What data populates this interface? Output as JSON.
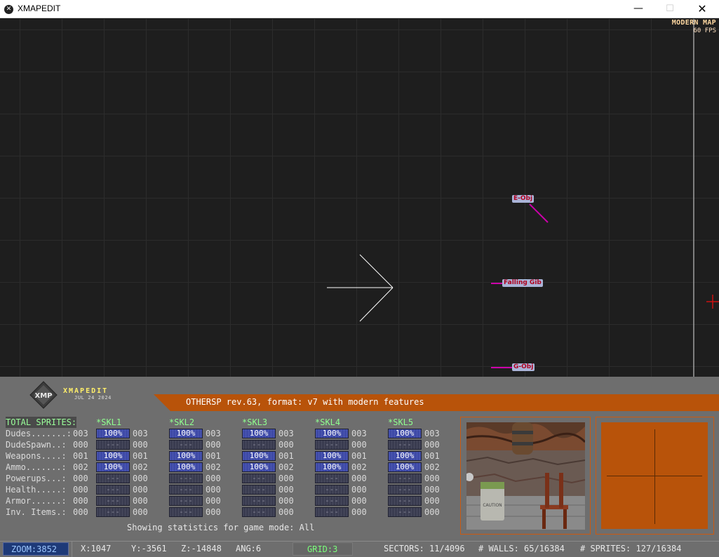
{
  "window": {
    "title": "XMAPEDIT",
    "minimize_glyph": "—",
    "maximize_glyph": "☐",
    "close_glyph": "✕"
  },
  "map": {
    "mode_label": "MODERN MAP",
    "fps_label": "60 FPS",
    "sprites": [
      {
        "label": "E-Obj"
      },
      {
        "label": "Falling Gib"
      },
      {
        "label": "G-Obj"
      }
    ]
  },
  "panel": {
    "logo_name": "XMAPEDIT",
    "logo_date": "JUL 24 2024",
    "map_info": "OTHERSP rev.63, format: v7 with modern features",
    "total_header": "TOTAL SPRITES:",
    "rows": [
      {
        "label": "Dudes.......:",
        "total": "003"
      },
      {
        "label": "DudeSpawn..:",
        "total": "000"
      },
      {
        "label": "Weapons....:",
        "total": "001"
      },
      {
        "label": "Ammo.......:",
        "total": "002"
      },
      {
        "label": "Powerups...:",
        "total": "000"
      },
      {
        "label": "Health.....:",
        "total": "000"
      },
      {
        "label": "Armor......:",
        "total": "000"
      },
      {
        "label": "Inv. Items.:",
        "total": "000"
      }
    ],
    "skills": [
      {
        "name": "*SKL1",
        "bars": [
          "100%",
          "---",
          "100%",
          "100%",
          "---",
          "---",
          "---",
          "---"
        ],
        "counts": [
          "003",
          "000",
          "001",
          "002",
          "000",
          "000",
          "000",
          "000"
        ]
      },
      {
        "name": "*SKL2",
        "bars": [
          "100%",
          "---",
          "100%",
          "100%",
          "---",
          "---",
          "---",
          "---"
        ],
        "counts": [
          "003",
          "000",
          "001",
          "002",
          "000",
          "000",
          "000",
          "000"
        ]
      },
      {
        "name": "*SKL3",
        "bars": [
          "100%",
          "---",
          "100%",
          "100%",
          "---",
          "---",
          "---",
          "---"
        ],
        "counts": [
          "003",
          "000",
          "001",
          "002",
          "000",
          "000",
          "000",
          "000"
        ]
      },
      {
        "name": "*SKL4",
        "bars": [
          "100%",
          "---",
          "100%",
          "100%",
          "---",
          "---",
          "---",
          "---"
        ],
        "counts": [
          "003",
          "000",
          "001",
          "002",
          "000",
          "000",
          "000",
          "000"
        ]
      },
      {
        "name": "*SKL5",
        "bars": [
          "100%",
          "---",
          "100%",
          "100%",
          "---",
          "---",
          "---",
          "---"
        ],
        "counts": [
          "003",
          "000",
          "001",
          "002",
          "000",
          "000",
          "000",
          "000"
        ]
      }
    ],
    "showing_text": "Showing statistics for game mode: All"
  },
  "status": {
    "zoom": "ZOOM:3852",
    "x": "X:1047",
    "y": "Y:-3561",
    "z": "Z:-14848",
    "ang": "ANG:6",
    "grid": "GRID:3",
    "sectors": "SECTORS: 11/4096",
    "walls": "# WALLS: 65/16384",
    "sprites": "# SPRITES: 127/16384"
  },
  "colors": {
    "accent_orange": "#b8530a",
    "sprite_magenta": "#cc00aa",
    "skill_header_green": "#8fff8f",
    "logo_yellow": "#ffef6a"
  }
}
